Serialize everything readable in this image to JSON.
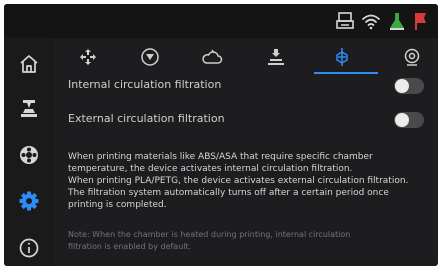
{
  "statusbar": {
    "icons": [
      "printer-icon",
      "wifi-icon",
      "user-icon",
      "flag-icon"
    ],
    "colors": {
      "user": "#3aa845",
      "flag": "#d63a3a"
    }
  },
  "sidebar": {
    "items": [
      {
        "icon": "home-icon"
      },
      {
        "icon": "print-bed-icon"
      },
      {
        "icon": "filament-icon"
      },
      {
        "icon": "settings-icon",
        "active": true
      },
      {
        "icon": "info-icon"
      }
    ],
    "accent": "#2b8df5"
  },
  "tabs": [
    {
      "icon": "move-axes-icon"
    },
    {
      "icon": "nozzle-icon"
    },
    {
      "icon": "fan-cloud-icon"
    },
    {
      "icon": "bed-level-icon"
    },
    {
      "icon": "filtration-icon",
      "active": true
    },
    {
      "icon": "camera-icon"
    }
  ],
  "settings": {
    "internal": {
      "label": "Internal circulation filtration",
      "enabled": false
    },
    "external": {
      "label": "External circulation filtration",
      "enabled": false
    }
  },
  "description": [
    "When printing materials like ABS/ASA that require specific chamber",
    "temperature, the device activates internal circulation filtration.",
    "When printing PLA/PETG, the device activates external circulation filtration.",
    "The filtration system automatically turns off after a certain period once",
    "printing is completed."
  ],
  "note": [
    "Note: When the chamber is heated during printing, internal circulation",
    "filtration is enabled by default."
  ]
}
